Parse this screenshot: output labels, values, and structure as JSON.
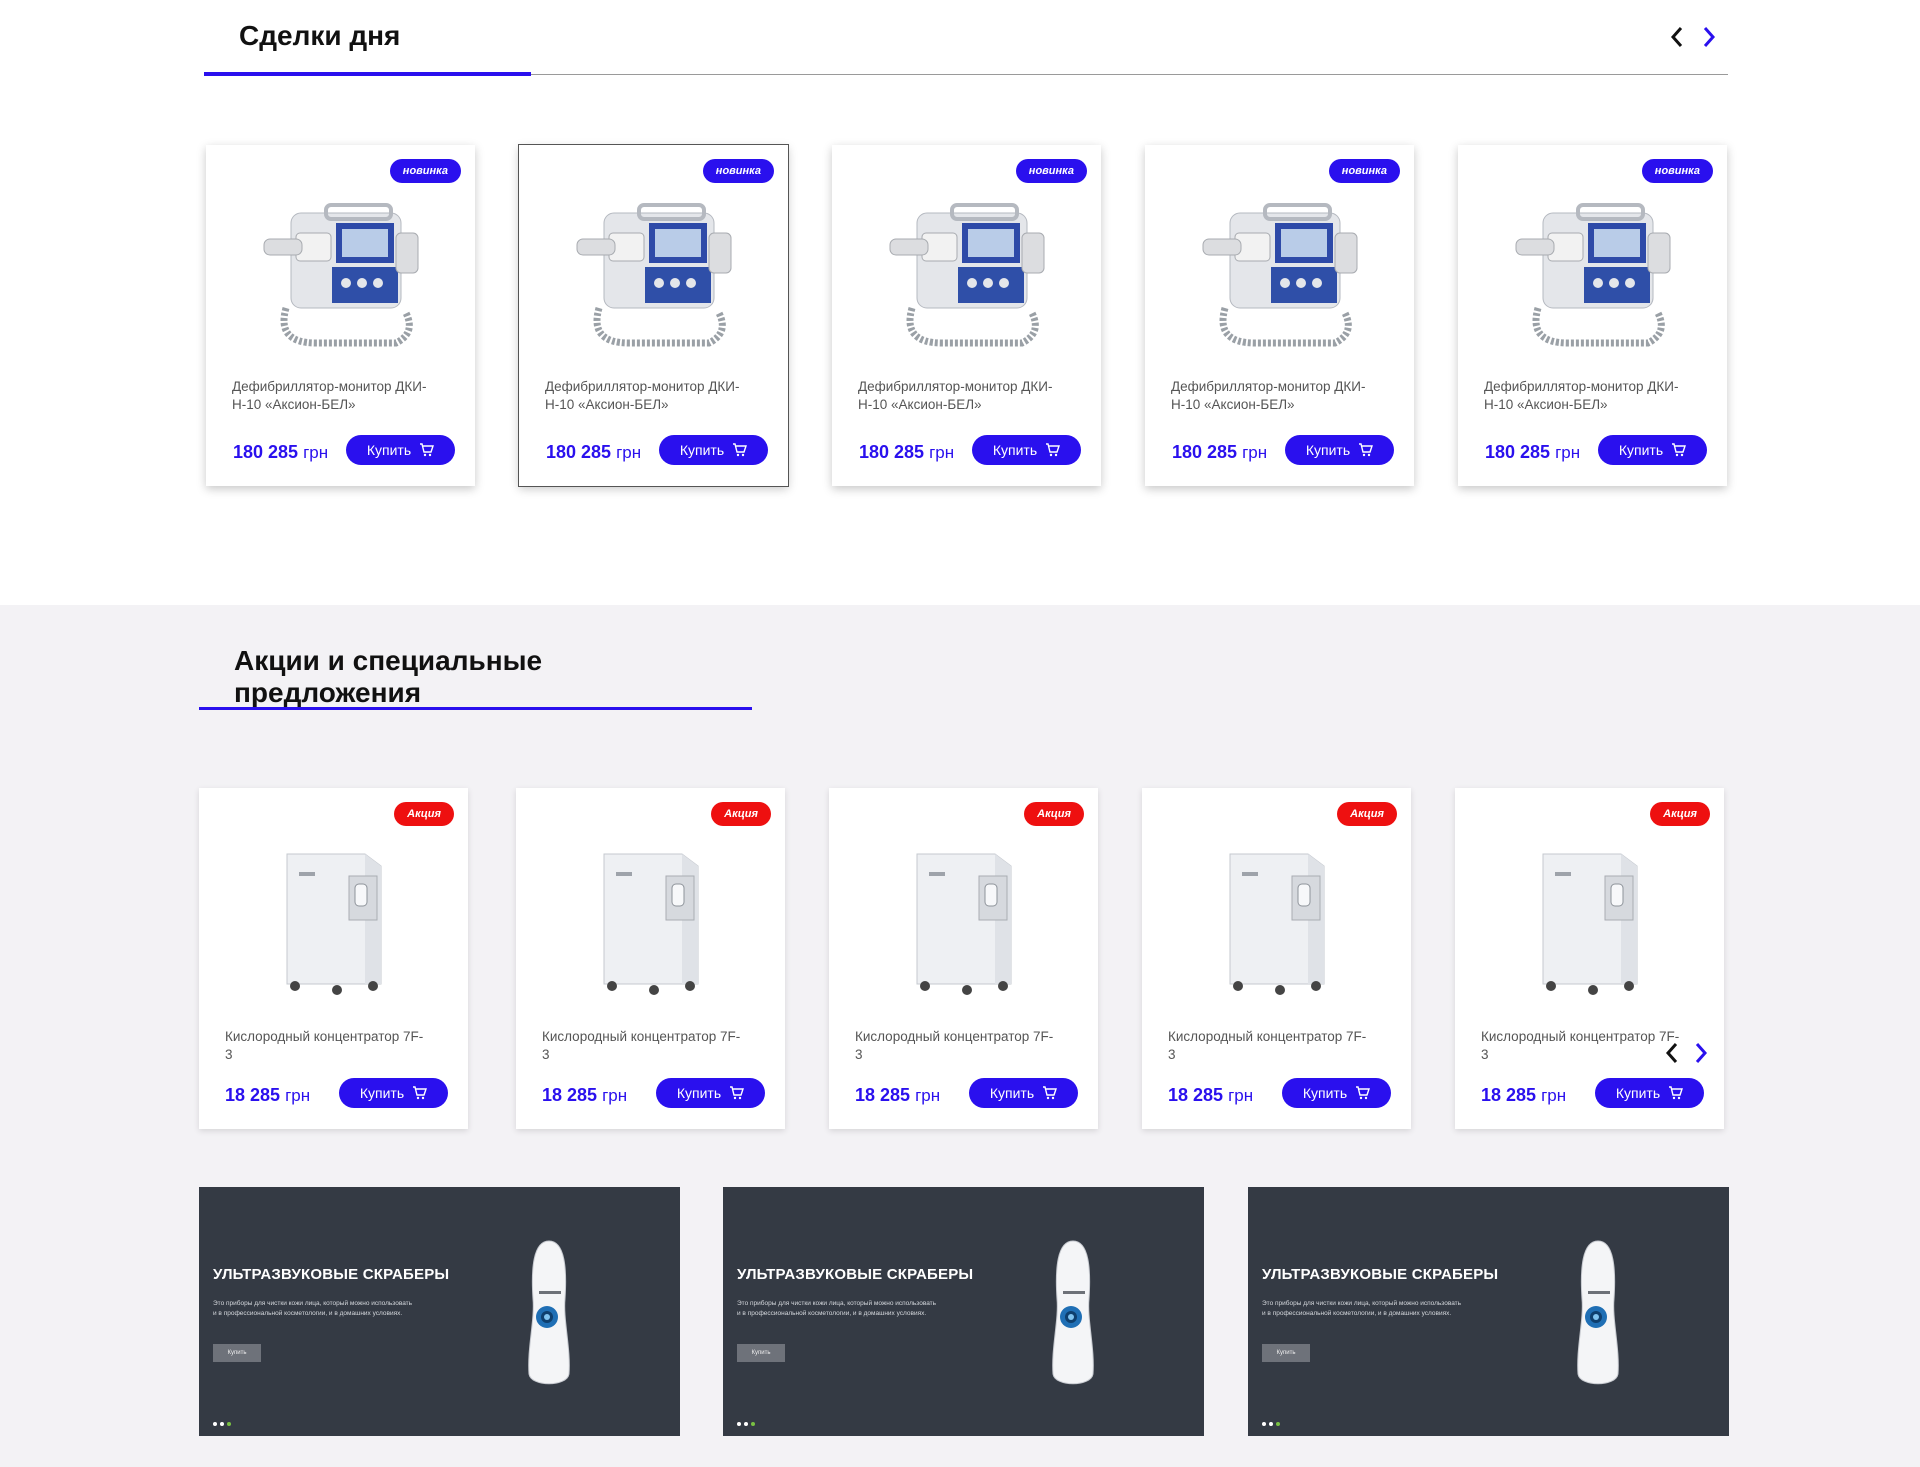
{
  "deals": {
    "title": "Сделки дня",
    "nav": {
      "prev_icon": "chevron-left-icon",
      "next_icon": "chevron-right-icon"
    },
    "products": [
      {
        "badge": "новинка",
        "name": "Дефибриллятор-монитор ДКИ-Н-10 «Аксион-БЕЛ»",
        "price": "180 285",
        "currency": "грн",
        "buy_label": "Купить"
      },
      {
        "badge": "новинка",
        "name": "Дефибриллятор-монитор ДКИ-Н-10 «Аксион-БЕЛ»",
        "price": "180 285",
        "currency": "грн",
        "buy_label": "Купить"
      },
      {
        "badge": "новинка",
        "name": "Дефибриллятор-монитор ДКИ-Н-10 «Аксион-БЕЛ»",
        "price": "180 285",
        "currency": "грн",
        "buy_label": "Купить"
      },
      {
        "badge": "новинка",
        "name": "Дефибриллятор-монитор ДКИ-Н-10 «Аксион-БЕЛ»",
        "price": "180 285",
        "currency": "грн",
        "buy_label": "Купить"
      },
      {
        "badge": "новинка",
        "name": "Дефибриллятор-монитор ДКИ-Н-10 «Аксион-БЕЛ»",
        "price": "180 285",
        "currency": "грн",
        "buy_label": "Купить"
      }
    ]
  },
  "promo": {
    "title": "Акции и специальные предложения",
    "products": [
      {
        "badge": "Акция",
        "name": "Кислородный концентратор 7F-3",
        "price": "18 285",
        "currency": "грн",
        "buy_label": "Купить"
      },
      {
        "badge": "Акция",
        "name": "Кислородный концентратор 7F-3",
        "price": "18 285",
        "currency": "грн",
        "buy_label": "Купить"
      },
      {
        "badge": "Акция",
        "name": "Кислородный концентратор 7F-3",
        "price": "18 285",
        "currency": "грн",
        "buy_label": "Купить"
      },
      {
        "badge": "Акция",
        "name": "Кислородный концентратор 7F-3",
        "price": "18 285",
        "currency": "грн",
        "buy_label": "Купить"
      },
      {
        "badge": "Акция",
        "name": "Кислородный концентратор 7F-3",
        "price": "18 285",
        "currency": "грн",
        "buy_label": "Купить"
      }
    ],
    "banners": [
      {
        "title": "УЛЬТРАЗВУКОВЫЕ СКРАБЕРЫ",
        "text": "Это приборы для чистки кожи лица, который можно использовать и в профессиональной косметологии, и в домашних условиях.",
        "button": "Купить"
      },
      {
        "title": "УЛЬТРАЗВУКОВЫЕ СКРАБЕРЫ",
        "text": "Это приборы для чистки кожи лица, который можно использовать и в профессиональной косметологии, и в домашних условиях.",
        "button": "Купить"
      },
      {
        "title": "УЛЬТРАЗВУКОВЫЕ СКРАБЕРЫ",
        "text": "Это приборы для чистки кожи лица, который можно использовать и в профессиональной косметологии, и в домашних условиях.",
        "button": "Купить"
      }
    ]
  },
  "colors": {
    "accent": "#2a10ee",
    "sale": "#ee1010",
    "banner_bg": "#343a44",
    "section_bg": "#f3f2f5"
  }
}
